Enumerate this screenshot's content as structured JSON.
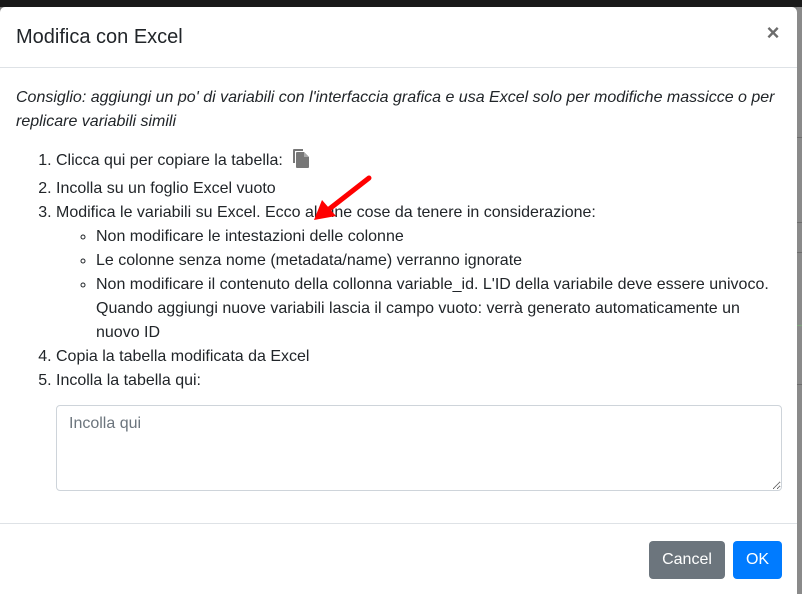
{
  "modal": {
    "title": "Modifica con Excel",
    "close_label": "×"
  },
  "body": {
    "tip": "Consiglio: aggiungi un po' di variabili con l'interfaccia grafica e usa Excel solo per modifiche massicce o per replicare variabili simili",
    "steps": [
      "Clicca qui per copiare la tabella:",
      "Incolla su un foglio Excel vuoto",
      "Modifica le variabili su Excel. Ecco alcune cose da tenere in considerazione:",
      "Copia la tabella modificata da Excel",
      "Incolla la tabella qui:"
    ],
    "notes": [
      "Non modificare le intestazioni delle colonne",
      "Le colonne senza nome (metadata/name) verranno ignorate",
      "Non modificare il contenuto della collonna variable_id. L'ID della variabile deve essere univoco. Quando aggiungi nuove variabili lascia il campo vuoto: verrà generato automaticamente un nuovo ID"
    ],
    "paste_placeholder": "Incolla qui",
    "copy_icon": "copy-icon",
    "annotation_arrow_color": "#ff0000"
  },
  "footer": {
    "cancel_label": "Cancel",
    "ok_label": "OK"
  },
  "colors": {
    "primary": "#007bff",
    "secondary": "#6c757d"
  }
}
